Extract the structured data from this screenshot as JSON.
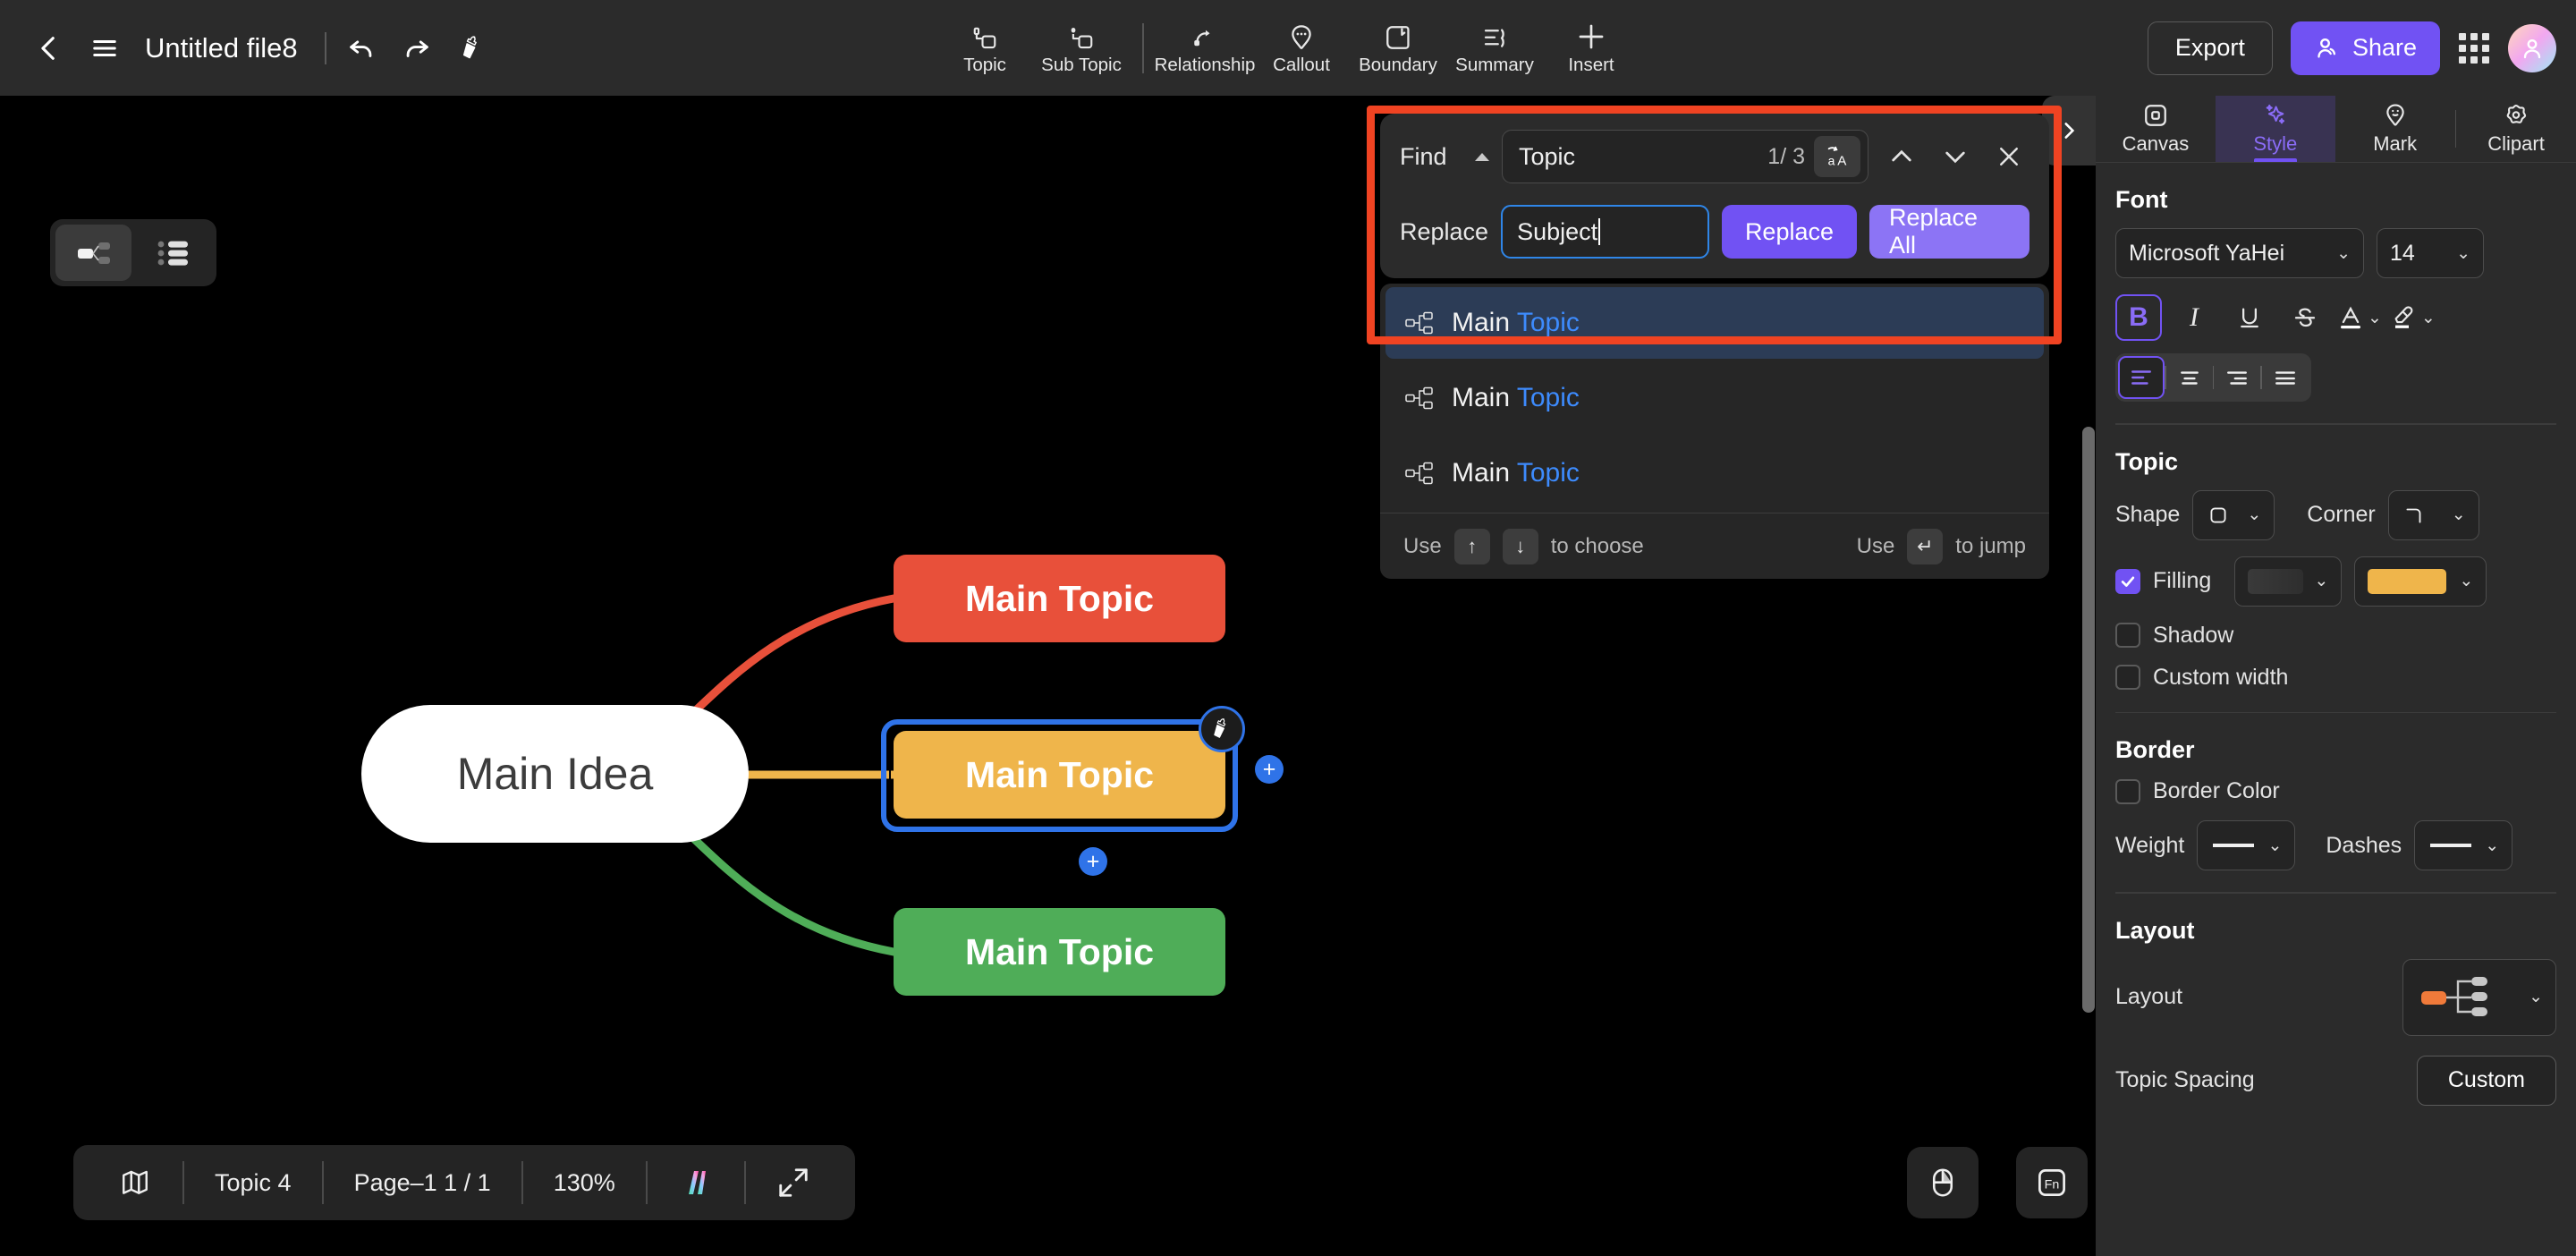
{
  "topbar": {
    "back_icon": "chevron-left-icon",
    "menu_icon": "hamburger-menu-icon",
    "title": "Untitled file8",
    "undo_icon": "undo-icon",
    "redo_icon": "redo-icon",
    "format_painter_icon": "format-painter-icon",
    "tools": [
      {
        "label": "Topic",
        "icon": "topic-icon"
      },
      {
        "label": "Sub Topic",
        "icon": "sub-topic-icon"
      },
      {
        "label": "Relationship",
        "icon": "relationship-icon"
      },
      {
        "label": "Callout",
        "icon": "callout-icon"
      },
      {
        "label": "Boundary",
        "icon": "boundary-icon"
      },
      {
        "label": "Summary",
        "icon": "summary-icon"
      },
      {
        "label": "Insert",
        "icon": "plus-icon"
      }
    ],
    "export_label": "Export",
    "share_label": "Share",
    "apps_icon": "app-grid-icon",
    "avatar_icon": "user-avatar"
  },
  "canvas": {
    "view_toggle": {
      "mindmap_icon": "mindmap-view-icon",
      "outline_icon": "outline-view-icon"
    },
    "nodes": {
      "root": "Main Idea",
      "red": "Main Topic",
      "yellow": "Main Topic",
      "green": "Main Topic"
    },
    "colors": {
      "root_bg": "#ffffff",
      "red_bg": "#e8503a",
      "yellow_bg": "#efb54b",
      "green_bg": "#4fad58",
      "selection": "#2f73e8"
    },
    "brush_icon": "format-painter-badge-icon",
    "add_sibling_icon": "plus-icon",
    "add_child_icon": "plus-icon"
  },
  "find": {
    "find_label": "Find",
    "collapse_icon": "caret-up-icon",
    "query": "Topic",
    "count": "1/ 3",
    "match_case_icon": "aA",
    "prev_icon": "chevron-up-icon",
    "next_icon": "chevron-down-icon",
    "close_icon": "close-icon",
    "replace_label": "Replace",
    "replace_value": "Subject",
    "replace_button": "Replace",
    "replace_all_button": "Replace All",
    "results": [
      {
        "prefix": "Main ",
        "match": "Topic",
        "icon": "topic-node-icon",
        "selected": true
      },
      {
        "prefix": "Main ",
        "match": "Topic",
        "icon": "topic-node-icon",
        "selected": false
      },
      {
        "prefix": "Main ",
        "match": "Topic",
        "icon": "topic-node-icon",
        "selected": false
      }
    ],
    "footer": {
      "use_1": "Use",
      "up_key": "↑",
      "down_key": "↓",
      "choose": "to choose",
      "use_2": "Use",
      "enter_key": "↵",
      "jump": "to jump"
    },
    "highlight_color": "#f04322"
  },
  "right_panel": {
    "collapse_icon": "chevron-right-icon",
    "tabs": [
      {
        "label": "Canvas",
        "icon": "canvas-icon",
        "active": false
      },
      {
        "label": "Style",
        "icon": "sparkle-icon",
        "active": true
      },
      {
        "label": "Mark",
        "icon": "mark-pin-icon",
        "active": false
      },
      {
        "label": "Clipart",
        "icon": "clipart-icon",
        "active": false
      }
    ],
    "font": {
      "section": "Font",
      "family": "Microsoft YaHei",
      "size": "14",
      "bold": "B",
      "italic": "I",
      "underline": "U",
      "strike": "S",
      "text_color_icon": "font-color-icon",
      "highlight_icon": "text-highlight-icon",
      "align_left_icon": "align-left-icon",
      "align_center_icon": "align-center-icon",
      "align_right_icon": "align-right-icon",
      "align_justify_icon": "align-justify-icon"
    },
    "topic": {
      "section": "Topic",
      "shape_label": "Shape",
      "shape_icon": "rounded-square-icon",
      "corner_label": "Corner",
      "corner_icon": "rounded-corner-icon",
      "filling_label": "Filling",
      "filling_checked": true,
      "filling_gradient": "#3a3a3a",
      "filling_color": "#efb54b",
      "shadow_label": "Shadow",
      "shadow_checked": false,
      "custom_width_label": "Custom width",
      "custom_width_checked": false
    },
    "border": {
      "section": "Border",
      "border_color_label": "Border Color",
      "border_color_checked": false,
      "weight_label": "Weight",
      "dashes_label": "Dashes"
    },
    "layout": {
      "section": "Layout",
      "layout_label": "Layout",
      "layout_icon": "right-tree-layout-icon",
      "topic_spacing_label": "Topic Spacing",
      "topic_spacing_value": "Custom"
    }
  },
  "statusbar": {
    "map_icon": "map-overview-icon",
    "topic_count": "Topic 4",
    "page": "Page–1  1 / 1",
    "zoom": "130%",
    "theme_icon": "theme-icon",
    "fullscreen_icon": "fullscreen-icon",
    "mouse_icon": "mouse-mode-icon",
    "fn_icon": "fn-shortcut-icon"
  }
}
